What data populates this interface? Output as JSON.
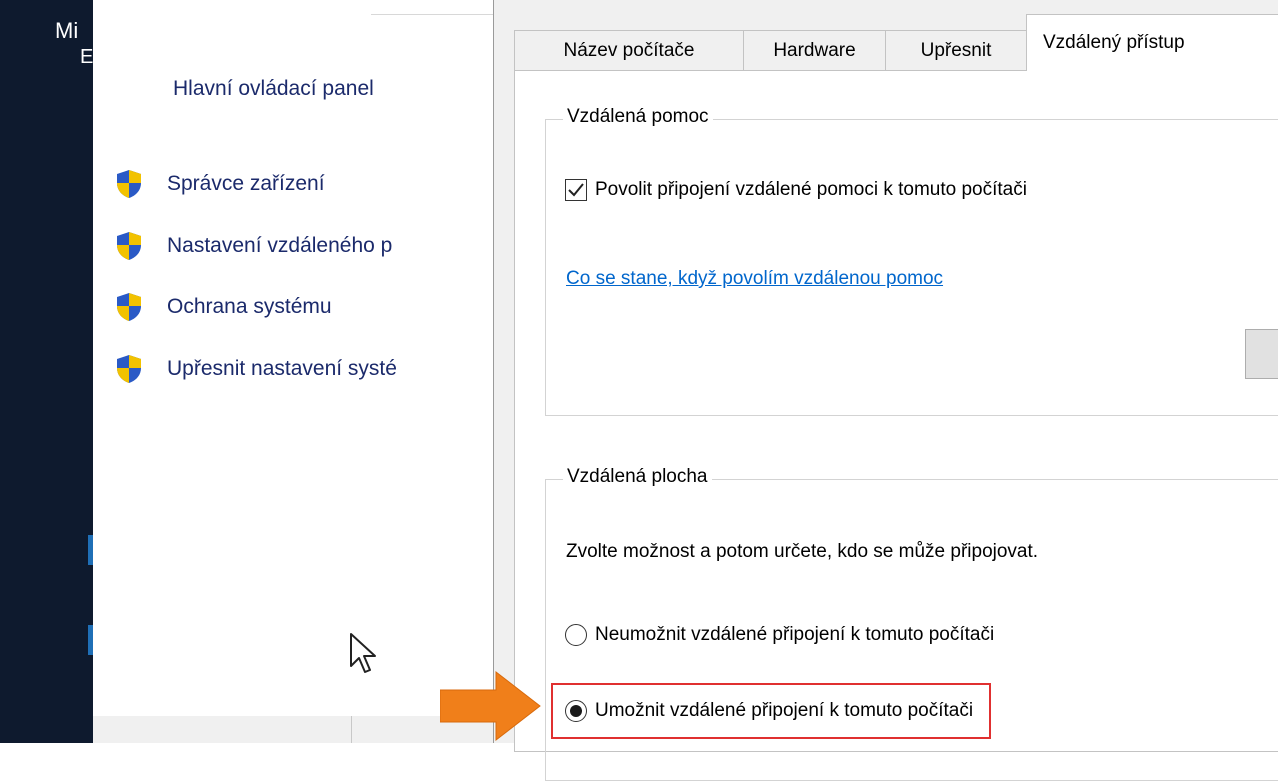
{
  "desktop": {
    "title_fragment": "Mi",
    "title_fragment2": "E"
  },
  "control_panel": {
    "home_link": "Hlavní ovládací panel",
    "items": [
      {
        "label": "Správce zařízení",
        "icon": "uac-shield-icon"
      },
      {
        "label": "Nastavení vzdáleného p",
        "icon": "uac-shield-icon"
      },
      {
        "label": "Ochrana systému",
        "icon": "uac-shield-icon"
      },
      {
        "label": "Upřesnit nastavení systé",
        "icon": "uac-shield-icon"
      }
    ]
  },
  "dialog": {
    "tabs": [
      {
        "label": "Název počítače",
        "active": false
      },
      {
        "label": "Hardware",
        "active": false
      },
      {
        "label": "Upřesnit",
        "active": false
      },
      {
        "label": "Vzdálený přístup",
        "active": true
      }
    ],
    "remote_assistance": {
      "title": "Vzdálená pomoc",
      "checkbox_label": "Povolit připojení vzdálené pomoci k tomuto počítači",
      "checkbox_checked": true,
      "help_link": "Co se stane, když povolím vzdálenou pomoc"
    },
    "remote_desktop": {
      "title": "Vzdálená plocha",
      "instruction": "Zvolte možnost a potom určete, kdo se může připojovat.",
      "options": [
        {
          "label": "Neumožnit vzdálené připojení k tomuto počítači",
          "selected": false
        },
        {
          "label": "Umožnit vzdálené připojení k tomuto počítači",
          "selected": true
        }
      ]
    }
  },
  "colors": {
    "link": "#0066cc",
    "nav_text": "#1b2a6b",
    "highlight": "#e03030",
    "arrow": "#f07f1a"
  }
}
